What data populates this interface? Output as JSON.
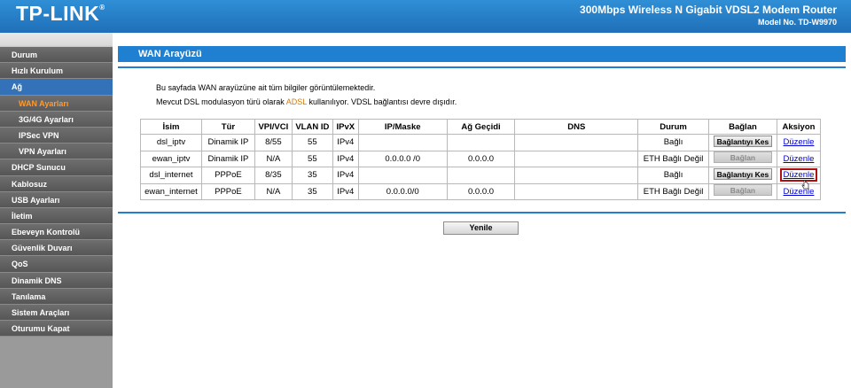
{
  "header": {
    "logo": "TP-LINK",
    "product_title": "300Mbps Wireless N Gigabit VDSL2 Modem Router",
    "model_no": "Model No. TD-W9970"
  },
  "sidebar": {
    "items": [
      {
        "label": "Durum"
      },
      {
        "label": "Hızlı Kurulum"
      },
      {
        "label": "Ağ"
      },
      {
        "label": "WAN Ayarları"
      },
      {
        "label": "3G/4G Ayarları"
      },
      {
        "label": "IPSec VPN"
      },
      {
        "label": "VPN Ayarları"
      },
      {
        "label": "DHCP Sunucu"
      },
      {
        "label": "Kablosuz"
      },
      {
        "label": "USB Ayarları"
      },
      {
        "label": "İletim"
      },
      {
        "label": "Ebeveyn Kontrolü"
      },
      {
        "label": "Güvenlik Duvarı"
      },
      {
        "label": "QoS"
      },
      {
        "label": "Dinamik DNS"
      },
      {
        "label": "Tanılama"
      },
      {
        "label": "Sistem Araçları"
      },
      {
        "label": "Oturumu Kapat"
      }
    ]
  },
  "main": {
    "section_title": "WAN Arayüzü",
    "desc1": "Bu sayfada WAN arayüzüne ait tüm bilgiler görüntülemektedir.",
    "desc2_prefix": "Mevcut DSL modulasyon türü olarak ",
    "desc2_adsl": "ADSL",
    "desc2_suffix": " kullanılıyor. VDSL bağlantısı devre dışıdır.",
    "table": {
      "headers": [
        "İsim",
        "Tür",
        "VPI/VCI",
        "VLAN ID",
        "IPvX",
        "IP/Maske",
        "Ağ Geçidi",
        "DNS",
        "Durum",
        "Bağlan",
        "Aksiyon"
      ],
      "rows": [
        {
          "name": "dsl_iptv",
          "type": "Dinamik IP",
          "vpivci": "8/55",
          "vlan": "55",
          "ipvx": "IPv4",
          "ip": "",
          "gateway": "",
          "dns": "",
          "status": "Bağlı",
          "connect": "Bağlantıyı Kes",
          "action": "Düzenle"
        },
        {
          "name": "ewan_iptv",
          "type": "Dinamik IP",
          "vpivci": "N/A",
          "vlan": "55",
          "ipvx": "IPv4",
          "ip": "0.0.0.0 /0",
          "gateway": "0.0.0.0",
          "dns": "",
          "status": "ETH Bağlı Değil",
          "connect": "Bağlan",
          "action": "Düzenle"
        },
        {
          "name": "dsl_internet",
          "type": "PPPoE",
          "vpivci": "8/35",
          "vlan": "35",
          "ipvx": "IPv4",
          "ip": "",
          "gateway": "",
          "dns": "",
          "status": "Bağlı",
          "connect": "Bağlantıyı Kes",
          "action": "Düzenle"
        },
        {
          "name": "ewan_internet",
          "type": "PPPoE",
          "vpivci": "N/A",
          "vlan": "35",
          "ipvx": "IPv4",
          "ip": "0.0.0.0/0",
          "gateway": "0.0.0.0",
          "dns": "",
          "status": "ETH Bağlı Değil",
          "connect": "Bağlan",
          "action": "Düzenle"
        }
      ]
    },
    "refresh_label": "Yenile"
  },
  "colors": {
    "header_blue": "#1f6fb8",
    "section_blue": "#1f7fd0",
    "active_menu": "#3372b8",
    "selected_submenu": "#ff9a2e",
    "highlight_box": "#b01010"
  },
  "icons": {
    "cursor": "hand-pointer-icon"
  }
}
